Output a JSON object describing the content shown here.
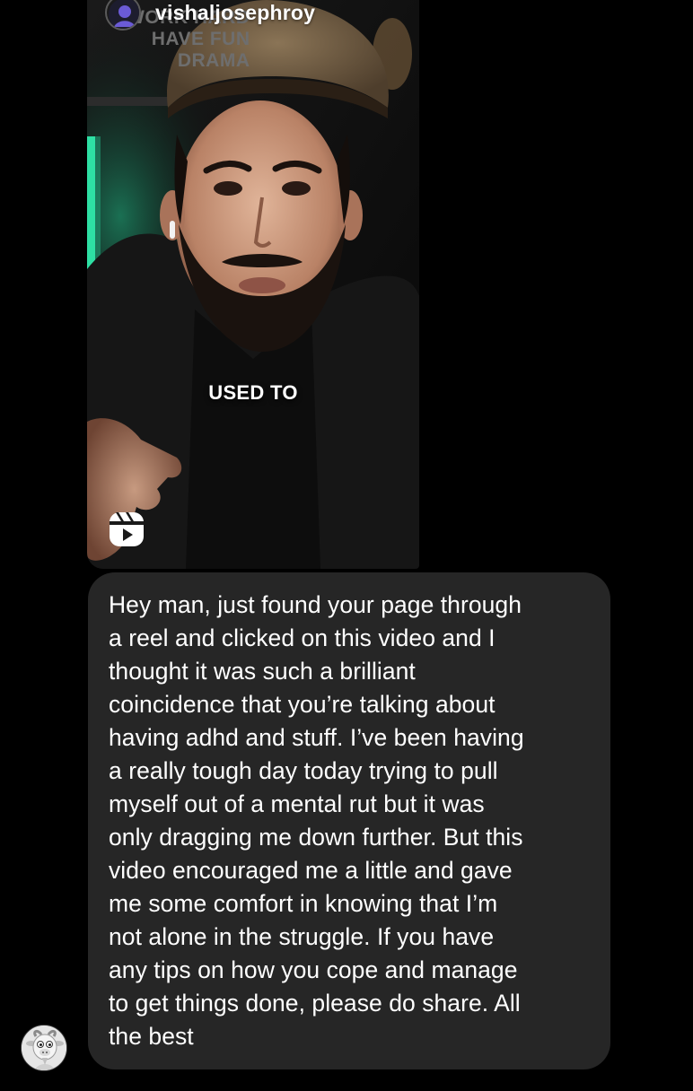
{
  "reel": {
    "username": "vishaljosephroy",
    "background_wall_text": [
      "WORK HARD",
      "HAVE FUN",
      "DRAMA"
    ],
    "caption": "USED TO",
    "icon": "reel-icon",
    "accent_light_color": "#22d19a"
  },
  "message": {
    "text": "Hey man, just found your page through\na reel and clicked on this video and I\nthought it was such a brilliant\ncoincidence that you’re talking about\nhaving adhd and stuff. I’ve been having\na really tough day today trying to pull\nmyself out of a mental rut but it was\nonly dragging me down further. But this\nvideo encouraged me a little and gave\nme some comfort in knowing that I’m\nnot alone in the struggle. If you have\nany tips on how you cope and manage\nto get things done, please do share. All\nthe best",
    "bubble_color": "#262626"
  },
  "sender": {
    "avatar_icon": "goat-avatar-icon"
  }
}
